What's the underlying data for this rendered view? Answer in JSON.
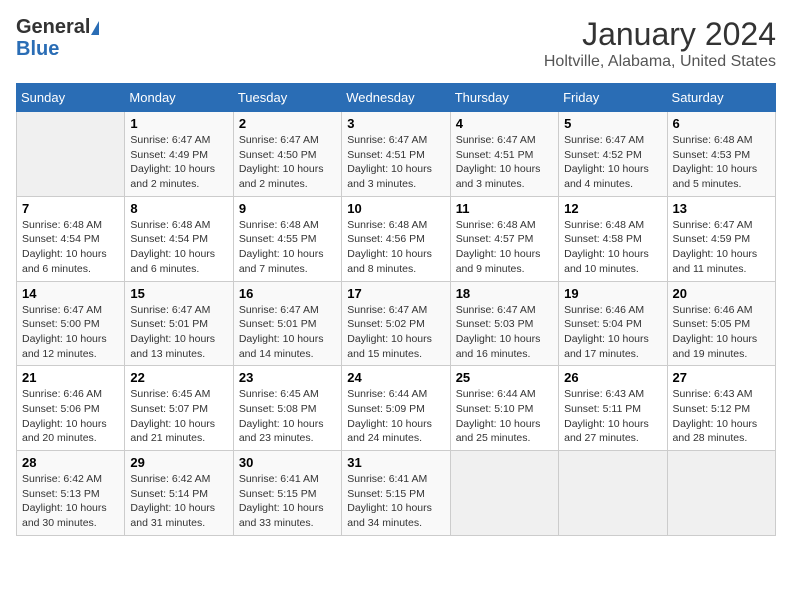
{
  "header": {
    "logo_general": "General",
    "logo_blue": "Blue",
    "month_title": "January 2024",
    "location": "Holtville, Alabama, United States"
  },
  "days_of_week": [
    "Sunday",
    "Monday",
    "Tuesday",
    "Wednesday",
    "Thursday",
    "Friday",
    "Saturday"
  ],
  "weeks": [
    [
      {
        "day": "",
        "info": ""
      },
      {
        "day": "1",
        "info": "Sunrise: 6:47 AM\nSunset: 4:49 PM\nDaylight: 10 hours\nand 2 minutes."
      },
      {
        "day": "2",
        "info": "Sunrise: 6:47 AM\nSunset: 4:50 PM\nDaylight: 10 hours\nand 2 minutes."
      },
      {
        "day": "3",
        "info": "Sunrise: 6:47 AM\nSunset: 4:51 PM\nDaylight: 10 hours\nand 3 minutes."
      },
      {
        "day": "4",
        "info": "Sunrise: 6:47 AM\nSunset: 4:51 PM\nDaylight: 10 hours\nand 3 minutes."
      },
      {
        "day": "5",
        "info": "Sunrise: 6:47 AM\nSunset: 4:52 PM\nDaylight: 10 hours\nand 4 minutes."
      },
      {
        "day": "6",
        "info": "Sunrise: 6:48 AM\nSunset: 4:53 PM\nDaylight: 10 hours\nand 5 minutes."
      }
    ],
    [
      {
        "day": "7",
        "info": "Sunrise: 6:48 AM\nSunset: 4:54 PM\nDaylight: 10 hours\nand 6 minutes."
      },
      {
        "day": "8",
        "info": "Sunrise: 6:48 AM\nSunset: 4:54 PM\nDaylight: 10 hours\nand 6 minutes."
      },
      {
        "day": "9",
        "info": "Sunrise: 6:48 AM\nSunset: 4:55 PM\nDaylight: 10 hours\nand 7 minutes."
      },
      {
        "day": "10",
        "info": "Sunrise: 6:48 AM\nSunset: 4:56 PM\nDaylight: 10 hours\nand 8 minutes."
      },
      {
        "day": "11",
        "info": "Sunrise: 6:48 AM\nSunset: 4:57 PM\nDaylight: 10 hours\nand 9 minutes."
      },
      {
        "day": "12",
        "info": "Sunrise: 6:48 AM\nSunset: 4:58 PM\nDaylight: 10 hours\nand 10 minutes."
      },
      {
        "day": "13",
        "info": "Sunrise: 6:47 AM\nSunset: 4:59 PM\nDaylight: 10 hours\nand 11 minutes."
      }
    ],
    [
      {
        "day": "14",
        "info": "Sunrise: 6:47 AM\nSunset: 5:00 PM\nDaylight: 10 hours\nand 12 minutes."
      },
      {
        "day": "15",
        "info": "Sunrise: 6:47 AM\nSunset: 5:01 PM\nDaylight: 10 hours\nand 13 minutes."
      },
      {
        "day": "16",
        "info": "Sunrise: 6:47 AM\nSunset: 5:01 PM\nDaylight: 10 hours\nand 14 minutes."
      },
      {
        "day": "17",
        "info": "Sunrise: 6:47 AM\nSunset: 5:02 PM\nDaylight: 10 hours\nand 15 minutes."
      },
      {
        "day": "18",
        "info": "Sunrise: 6:47 AM\nSunset: 5:03 PM\nDaylight: 10 hours\nand 16 minutes."
      },
      {
        "day": "19",
        "info": "Sunrise: 6:46 AM\nSunset: 5:04 PM\nDaylight: 10 hours\nand 17 minutes."
      },
      {
        "day": "20",
        "info": "Sunrise: 6:46 AM\nSunset: 5:05 PM\nDaylight: 10 hours\nand 19 minutes."
      }
    ],
    [
      {
        "day": "21",
        "info": "Sunrise: 6:46 AM\nSunset: 5:06 PM\nDaylight: 10 hours\nand 20 minutes."
      },
      {
        "day": "22",
        "info": "Sunrise: 6:45 AM\nSunset: 5:07 PM\nDaylight: 10 hours\nand 21 minutes."
      },
      {
        "day": "23",
        "info": "Sunrise: 6:45 AM\nSunset: 5:08 PM\nDaylight: 10 hours\nand 23 minutes."
      },
      {
        "day": "24",
        "info": "Sunrise: 6:44 AM\nSunset: 5:09 PM\nDaylight: 10 hours\nand 24 minutes."
      },
      {
        "day": "25",
        "info": "Sunrise: 6:44 AM\nSunset: 5:10 PM\nDaylight: 10 hours\nand 25 minutes."
      },
      {
        "day": "26",
        "info": "Sunrise: 6:43 AM\nSunset: 5:11 PM\nDaylight: 10 hours\nand 27 minutes."
      },
      {
        "day": "27",
        "info": "Sunrise: 6:43 AM\nSunset: 5:12 PM\nDaylight: 10 hours\nand 28 minutes."
      }
    ],
    [
      {
        "day": "28",
        "info": "Sunrise: 6:42 AM\nSunset: 5:13 PM\nDaylight: 10 hours\nand 30 minutes."
      },
      {
        "day": "29",
        "info": "Sunrise: 6:42 AM\nSunset: 5:14 PM\nDaylight: 10 hours\nand 31 minutes."
      },
      {
        "day": "30",
        "info": "Sunrise: 6:41 AM\nSunset: 5:15 PM\nDaylight: 10 hours\nand 33 minutes."
      },
      {
        "day": "31",
        "info": "Sunrise: 6:41 AM\nSunset: 5:15 PM\nDaylight: 10 hours\nand 34 minutes."
      },
      {
        "day": "",
        "info": ""
      },
      {
        "day": "",
        "info": ""
      },
      {
        "day": "",
        "info": ""
      }
    ]
  ]
}
